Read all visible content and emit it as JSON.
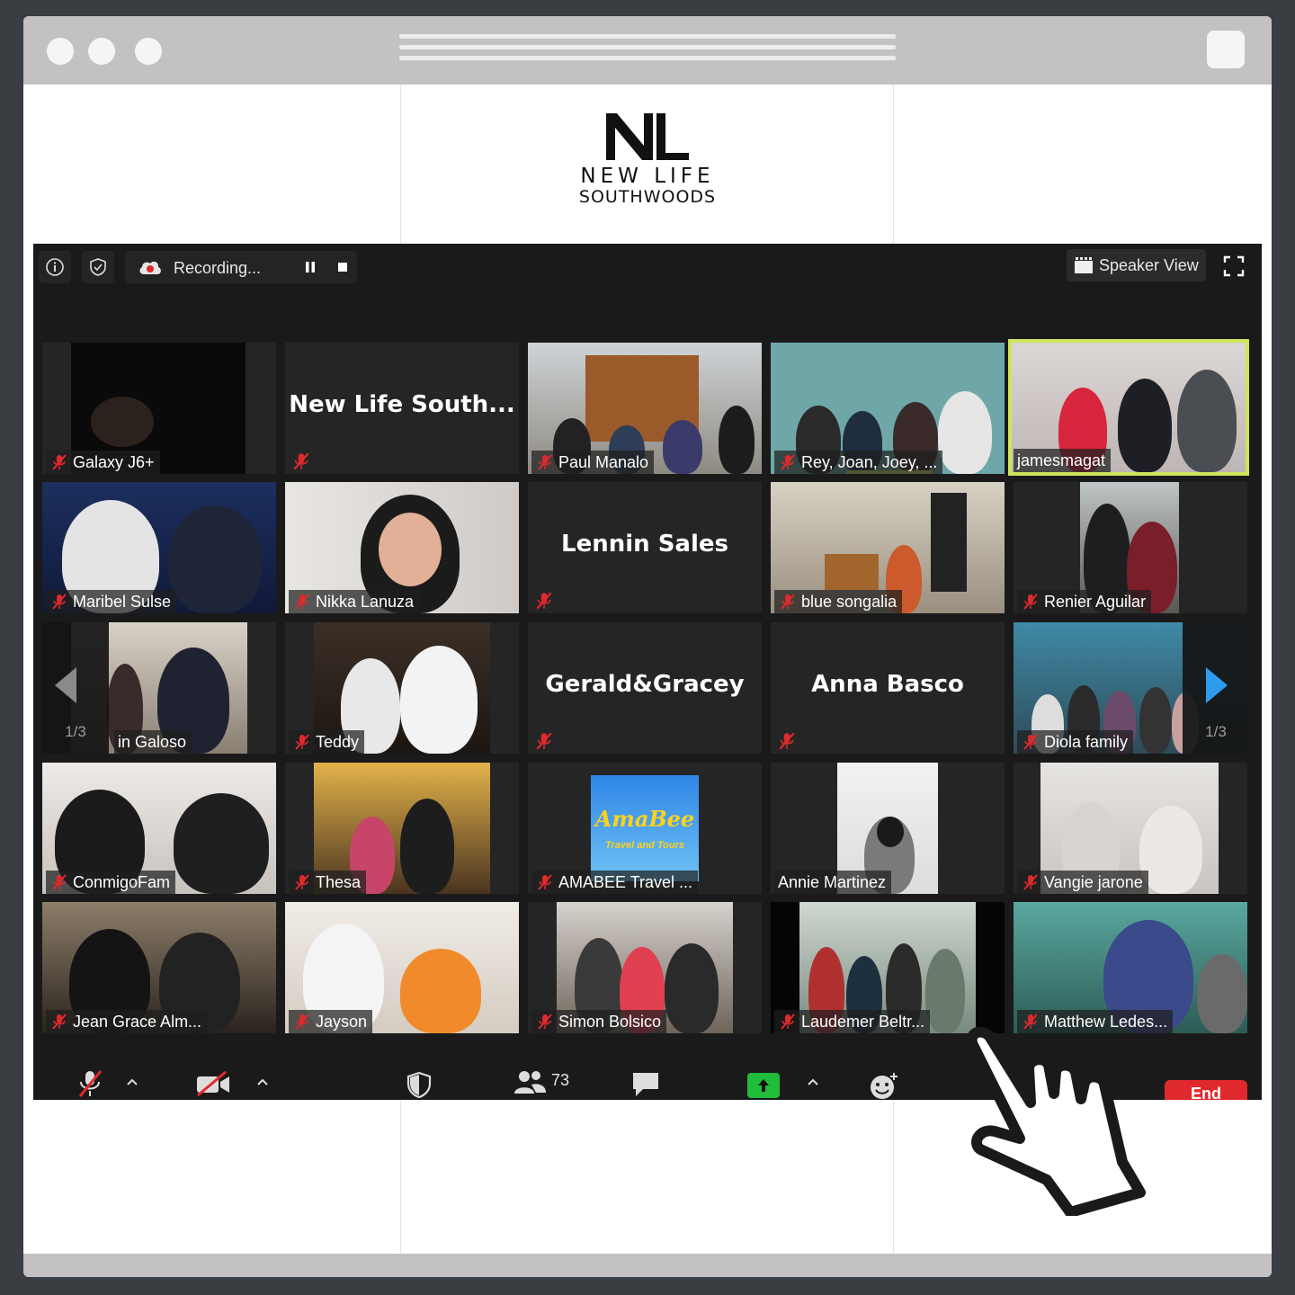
{
  "logo": {
    "line1": "NEW LIFE",
    "line2": "SOUTHWOODS"
  },
  "toolbar_top": {
    "recording_label": "Recording...",
    "view_label": "Speaker View"
  },
  "tiles": [
    {
      "name": "Galaxy J6+"
    },
    {
      "name": "",
      "display": "New Life South..."
    },
    {
      "name": "Paul Manalo"
    },
    {
      "name": "Rey, Joan, Joey, ..."
    },
    {
      "name": "jamesmagat"
    },
    {
      "name": "Maribel Sulse"
    },
    {
      "name": "Nikka Lanuza"
    },
    {
      "name": "",
      "display": "Lennin Sales"
    },
    {
      "name": "blue songalia"
    },
    {
      "name": "Renier Aguilar"
    },
    {
      "name": "in Galoso"
    },
    {
      "name": "Teddy"
    },
    {
      "name": "",
      "display": "Gerald&Gracey"
    },
    {
      "name": "",
      "display": "Anna Basco"
    },
    {
      "name": "Diola family"
    },
    {
      "name": "ConmigoFam"
    },
    {
      "name": "Thesa"
    },
    {
      "name": "AMABEE Travel ..."
    },
    {
      "name": "Annie Martinez"
    },
    {
      "name": "Vangie jarone"
    },
    {
      "name": "Jean Grace Alm..."
    },
    {
      "name": "Jayson"
    },
    {
      "name": "Simon Bolsico"
    },
    {
      "name": "Laudemer Beltr..."
    },
    {
      "name": "Matthew Ledes..."
    }
  ],
  "amabee_logo": {
    "brand": "AmaBee",
    "tagline": "Travel and Tours"
  },
  "pagination": {
    "left": "1/3",
    "right": "1/3"
  },
  "toolbar_bottom": {
    "participants_count": "73",
    "end_label": "End"
  },
  "colors": {
    "active_speaker": "#cfe55a",
    "end_button": "#e0292c",
    "share_button": "#1fbd3a",
    "muted_icon": "#e0292c"
  }
}
